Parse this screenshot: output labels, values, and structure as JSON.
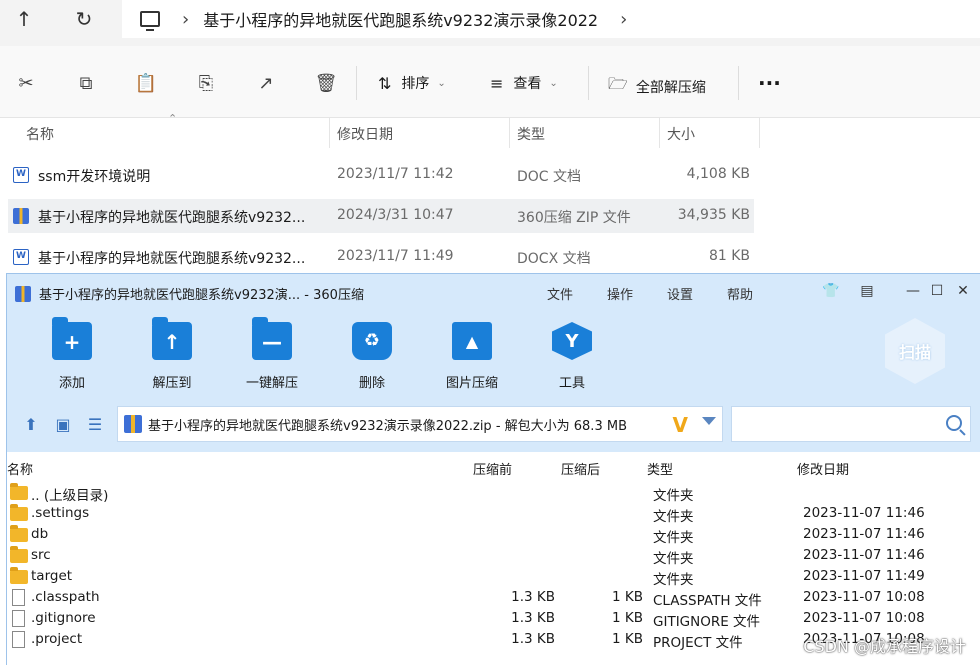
{
  "explorer": {
    "breadcrumb": "基于小程序的异地就医代跑腿系统v9232演示录像2022",
    "toolbar": {
      "sort_label": "排序",
      "view_label": "查看",
      "extract_all_label": "全部解压缩",
      "more_label": "..."
    },
    "columns": {
      "name": "名称",
      "modified": "修改日期",
      "type": "类型",
      "size": "大小"
    },
    "rows": [
      {
        "name": "ssm开发环境说明",
        "modified": "2023/11/7 11:42",
        "type": "DOC 文档",
        "size": "4,108 KB",
        "icon": "word-doc-icon"
      },
      {
        "name": "基于小程序的异地就医代跑腿系统v9232...",
        "modified": "2024/3/31 10:47",
        "type": "360压缩 ZIP 文件",
        "size": "34,935 KB",
        "icon": "zip-archive-icon"
      },
      {
        "name": "基于小程序的异地就医代跑腿系统v9232...",
        "modified": "2023/11/7 11:49",
        "type": "DOCX 文档",
        "size": "81 KB",
        "icon": "word-docx-icon"
      }
    ]
  },
  "zip": {
    "window_title": "基于小程序的异地就医代跑腿系统v9232演... - 360压缩",
    "menu": [
      "文件",
      "操作",
      "设置",
      "帮助"
    ],
    "actions": [
      "添加",
      "解压到",
      "一键解压",
      "删除",
      "图片压缩",
      "工具"
    ],
    "scan_label": "扫描",
    "path": "基于小程序的异地就医代跑腿系统v9232演示录像2022.zip - 解包大小为 68.3 MB",
    "columns": {
      "name": "名称",
      "before": "压缩前",
      "after": "压缩后",
      "type": "类型",
      "modified": "修改日期"
    },
    "rows": [
      {
        "name": ".. (上级目录)",
        "before": "",
        "after": "",
        "type": "文件夹",
        "modified": "",
        "kind": "folder"
      },
      {
        "name": ".settings",
        "before": "",
        "after": "",
        "type": "文件夹",
        "modified": "2023-11-07 11:46",
        "kind": "folder"
      },
      {
        "name": "db",
        "before": "",
        "after": "",
        "type": "文件夹",
        "modified": "2023-11-07 11:46",
        "kind": "folder"
      },
      {
        "name": "src",
        "before": "",
        "after": "",
        "type": "文件夹",
        "modified": "2023-11-07 11:46",
        "kind": "folder"
      },
      {
        "name": "target",
        "before": "",
        "after": "",
        "type": "文件夹",
        "modified": "2023-11-07 11:49",
        "kind": "folder"
      },
      {
        "name": ".classpath",
        "before": "1.3 KB",
        "after": "1 KB",
        "type": "CLASSPATH 文件",
        "modified": "2023-11-07 10:08",
        "kind": "file"
      },
      {
        "name": ".gitignore",
        "before": "1.3 KB",
        "after": "1 KB",
        "type": "GITIGNORE 文件",
        "modified": "2023-11-07 10:08",
        "kind": "file"
      },
      {
        "name": ".project",
        "before": "1.3 KB",
        "after": "1 KB",
        "type": "PROJECT 文件",
        "modified": "2023-11-07 10:08",
        "kind": "file"
      }
    ]
  },
  "watermark": "CSDN @成承程序设计",
  "colors": {
    "zip_accent": "#1a7fd8",
    "zip_header_bg": "#d6e9fb",
    "folder_yellow": "#f2b62a"
  }
}
